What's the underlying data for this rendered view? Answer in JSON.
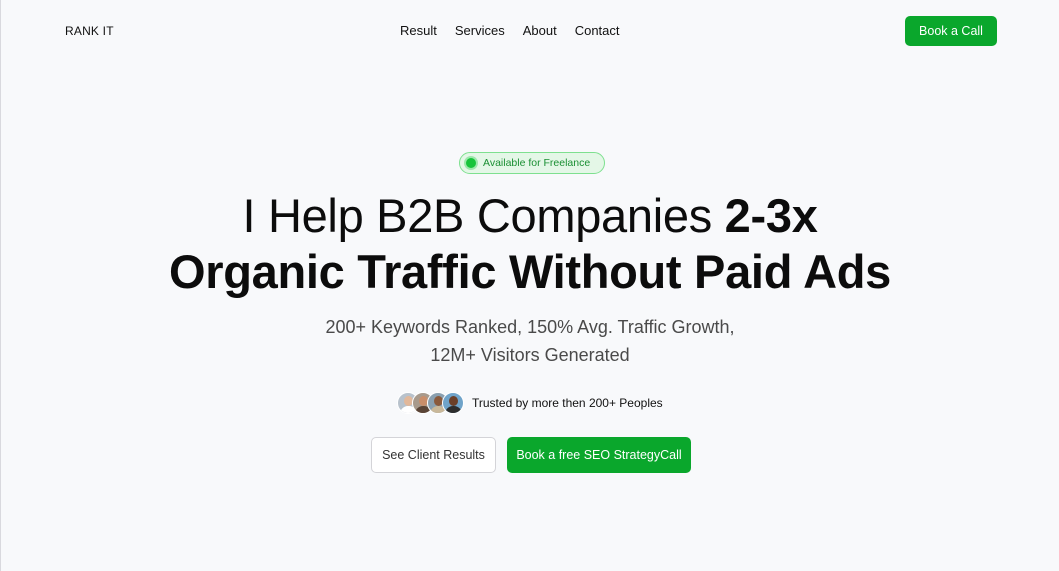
{
  "nav": {
    "logo": "RANK IT",
    "links": [
      {
        "label": "Result"
      },
      {
        "label": "Services"
      },
      {
        "label": "About"
      },
      {
        "label": "Contact"
      }
    ],
    "cta": "Book a Call"
  },
  "hero": {
    "badge": "Available for Freelance",
    "headline_light": "I Help B2B Companies ",
    "headline_bold_1": "2-3x",
    "headline_bold_2": "Organic Traffic Without Paid Ads",
    "subtitle_line1": "200+ Keywords Ranked, 150% Avg. Traffic Growth,",
    "subtitle_line2": "12M+ Visitors Generated",
    "trust_text": "Trusted by more then 200+ Peoples",
    "avatars": [
      {
        "name": "avatar-1",
        "bg": "#b8c2cc",
        "skin": "#e2b89a",
        "shirt": "#ffffff"
      },
      {
        "name": "avatar-2",
        "bg": "#a89a8c",
        "skin": "#c98e6a",
        "shirt": "#5a4436"
      },
      {
        "name": "avatar-3",
        "bg": "#8aa0b0",
        "skin": "#8a5a3c",
        "shirt": "#c9b89a"
      },
      {
        "name": "avatar-4",
        "bg": "#6fa3c9",
        "skin": "#6b3f28",
        "shirt": "#2d2d2d"
      }
    ],
    "btn_secondary": "See Client Results",
    "btn_primary": "Book a free SEO StrategyCall"
  },
  "colors": {
    "accent": "#0aa72c",
    "background": "#f8f9fb",
    "badge_bg": "#e4f7e7",
    "badge_dot": "#17c43b"
  }
}
